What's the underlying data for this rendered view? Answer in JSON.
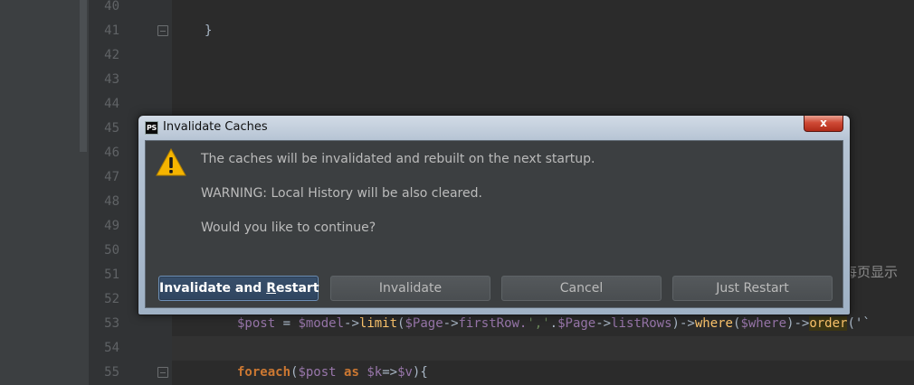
{
  "editor": {
    "line_numbers": [
      "40",
      "41",
      "42",
      "43",
      "44",
      "45",
      "46",
      "47",
      "48",
      "49",
      "50",
      "51",
      "52",
      "53",
      "54",
      "55"
    ],
    "closing_brace": "}",
    "behind_text": "每页显示"
  },
  "code_line_53": {
    "v1": "$post",
    "op1": " = ",
    "v2": "$model",
    "a1": "->",
    "f1": "limit",
    "p1": "(",
    "v3": "$Page",
    "a2": "->",
    "prop1": "firstRow.",
    "s1": "','",
    "dot": ".",
    "v4": "$Page",
    "a3": "->",
    "prop2": "listRows",
    "p2": ")",
    "a4": "->",
    "f2": "where",
    "p3": "(",
    "v5": "$where",
    "p4": ")",
    "a5": "->",
    "f3": "order",
    "p5": "('`"
  },
  "code_line_55": {
    "kw1": "foreach",
    "p1": "(",
    "v1": "$post",
    "sp1": " ",
    "kw2": "as",
    "sp2": " ",
    "v2": "$k",
    "arrow": "=>",
    "v3": "$v",
    "p2": "){"
  },
  "dialog": {
    "app_icon": "PS",
    "title": "Invalidate Caches",
    "close_symbol": "x",
    "messages": {
      "line1": "The caches will be invalidated and rebuilt on the next startup.",
      "line2": "WARNING: Local History will be also cleared.",
      "line3": "Would you like to continue?"
    },
    "warning_icon": "warning-triangle-icon",
    "buttons": {
      "invalidate_restart_a": "Invalidate and ",
      "invalidate_restart_mnemonic": "R",
      "invalidate_restart_b": "estart",
      "invalidate": "Invalidate",
      "cancel": "Cancel",
      "just_restart": "Just Restart"
    }
  },
  "colors": {
    "editor_bg": "#2b2b2b",
    "gutter_bg": "#313335",
    "dialog_content_bg": "#3c3f41",
    "default_button": "#2f4560",
    "warning_yellow": "#f5b400"
  }
}
